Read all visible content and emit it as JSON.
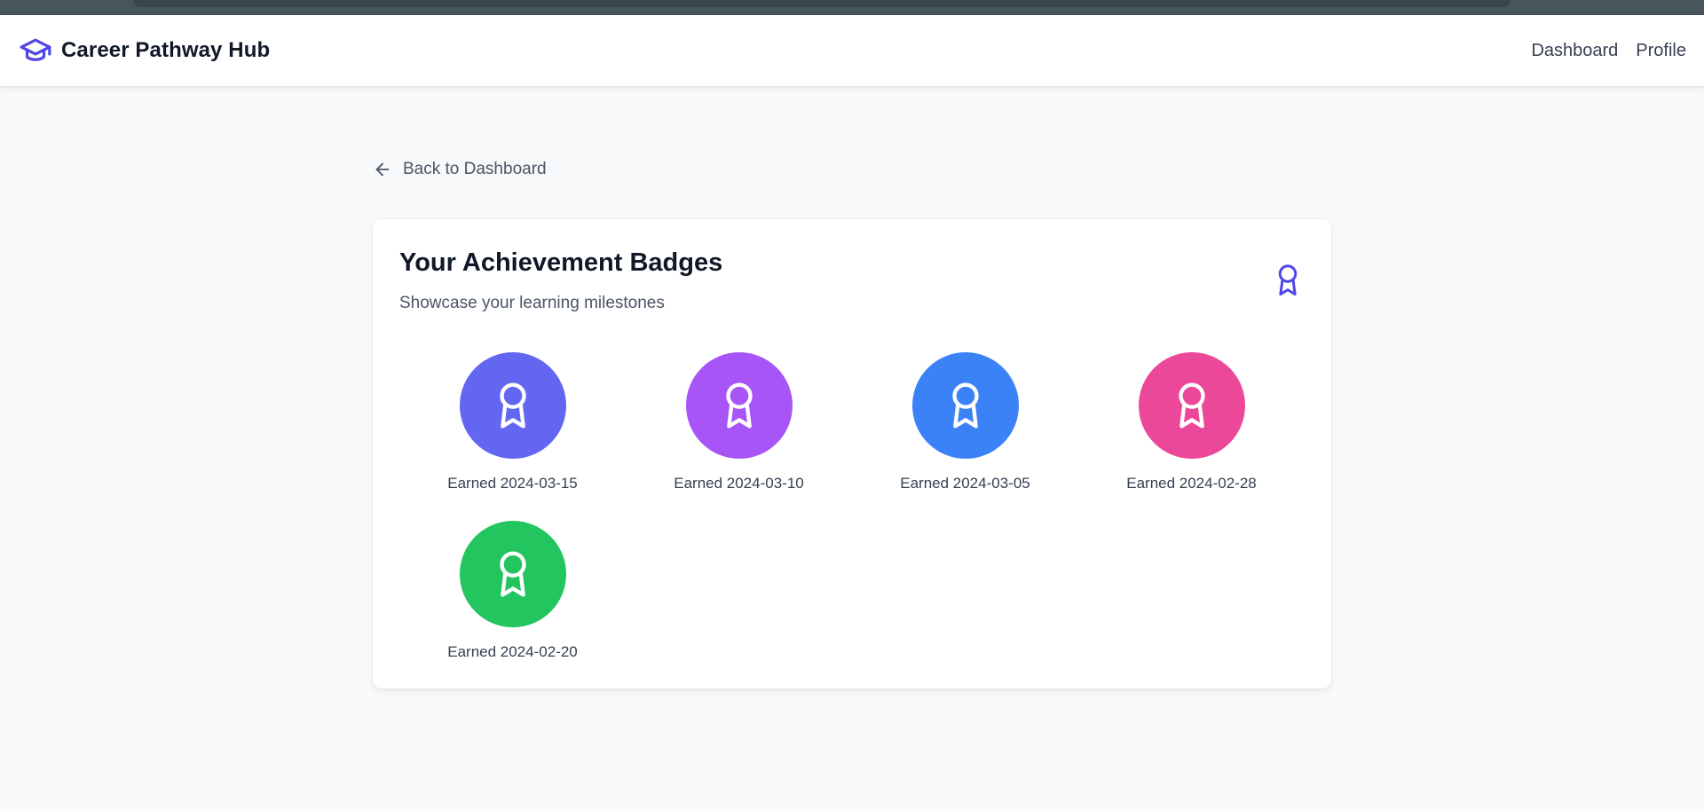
{
  "header": {
    "brand_name": "Career Pathway Hub",
    "brand_icon": "graduation-cap-icon",
    "nav": [
      {
        "label": "Dashboard"
      },
      {
        "label": "Profile"
      }
    ]
  },
  "back_link": {
    "label": "Back to Dashboard",
    "icon": "arrow-left-icon"
  },
  "badges_card": {
    "title": "Your Achievement Badges",
    "subtitle": "Showcase your learning milestones",
    "icon": "award-icon",
    "badges": [
      {
        "earned": "Earned 2024-03-15",
        "color": "#6366f1",
        "icon": "award-icon"
      },
      {
        "earned": "Earned 2024-03-10",
        "color": "#a855f7",
        "icon": "award-icon"
      },
      {
        "earned": "Earned 2024-03-05",
        "color": "#3b82f6",
        "icon": "award-icon"
      },
      {
        "earned": "Earned 2024-02-28",
        "color": "#ec4899",
        "icon": "award-icon"
      },
      {
        "earned": "Earned 2024-02-20",
        "color": "#22c55e",
        "icon": "award-icon"
      }
    ]
  },
  "colors": {
    "accent": "#4f46e5",
    "text_primary": "#111827",
    "text_secondary": "#4b5563",
    "page_background": "#f8f9fb"
  }
}
